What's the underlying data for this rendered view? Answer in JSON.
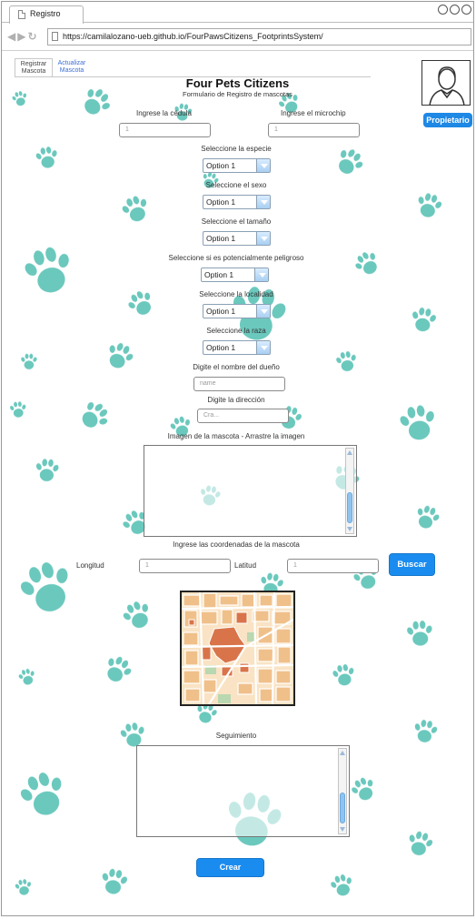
{
  "browser": {
    "tab_title": "Registro",
    "url": "https://camilalozano-ueb.github.io/FourPawsCitizens_FootprintsSystem/"
  },
  "subnav": {
    "tab1": "Registrar\nMascota",
    "tab2": "Actualizar\nMascota"
  },
  "header": {
    "title": "Four Pets Citizens",
    "subtitle": "Formulario de Registro de mascotas",
    "owner_button": "Propietario"
  },
  "form": {
    "cedula_label": "Ingrese la cédula",
    "cedula_value": "1",
    "microchip_label": "Ingrese el microchip",
    "microchip_value": "1",
    "especie_label": "Seleccione la especie",
    "especie_value": "Option 1",
    "sexo_label": "Seleccione el sexo",
    "sexo_value": "Option 1",
    "tamano_label": "Seleccione el tamaño",
    "tamano_value": "Option 1",
    "peligroso_label": "Seleccione si es potencialmente peligroso",
    "peligroso_value": "Option 1",
    "localidad_label": "Seleccione la localidad",
    "localidad_value": "Option 1",
    "raza_label": "Seleccione la raza",
    "raza_value": "Option 1",
    "dueno_label": "Digite el nombre del dueño",
    "dueno_placeholder": "name",
    "direccion_label": "Digite la dirección",
    "direccion_placeholder": "Cra...",
    "imagen_label": "Imagen de la mascota - Arrastre la imagen",
    "coordenadas_label": "Ingrese las coordenadas de la mascota",
    "longitud_label": "Longitud",
    "longitud_value": "1",
    "latitud_label": "Latitud",
    "latitud_value": "1",
    "buscar_button": "Buscar",
    "seguimiento_label": "Seguimiento",
    "crear_button": "Crear"
  },
  "colors": {
    "paw": "#5ec4b8",
    "accent_blue": "#1a8cf0"
  }
}
